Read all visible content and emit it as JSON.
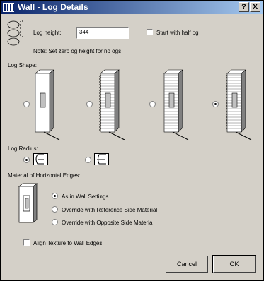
{
  "window": {
    "title": "Wall - Log Details",
    "help_button": "?",
    "close_button": "X"
  },
  "log_height": {
    "label": "Log height:",
    "value": "344",
    "start_half_log_label": "Start with half og",
    "note": "Note: Set zero og height for no ogs"
  },
  "log_shape": {
    "label": "Log Shape:",
    "options": [
      "flat-flat",
      "rounded-flat",
      "flat-rounded",
      "rounded-rounded"
    ],
    "selected": 3
  },
  "log_radius": {
    "label": "Log Radius:",
    "options": [
      "radius-outer",
      "radius-inner"
    ],
    "selected": 0
  },
  "material": {
    "label": "Material of Horizontal Edges:",
    "options": [
      "As in Wall Settings",
      "Override with Reference Side Material",
      "Override with Opposite Side Materia"
    ],
    "selected": 0
  },
  "align_texture_label": "Align Texture to Wall Edges",
  "buttons": {
    "cancel": "Cancel",
    "ok": "OK"
  }
}
